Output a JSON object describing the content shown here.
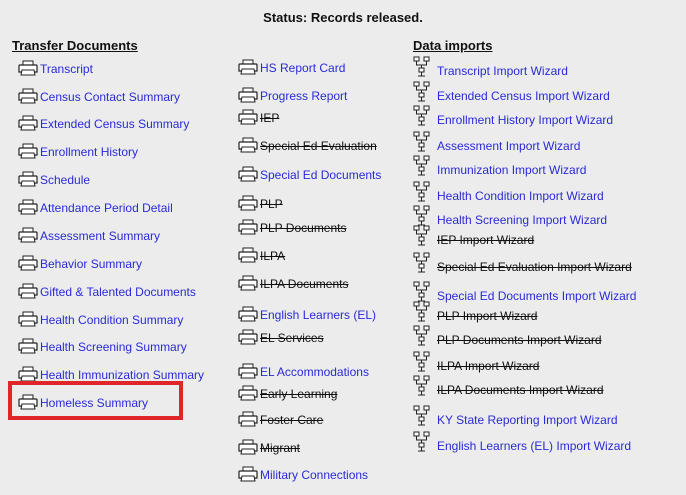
{
  "status": "Status: Records released.",
  "columns": {
    "transfer": {
      "header": "Transfer Documents",
      "items": [
        {
          "label": "Transcript",
          "struck": false
        },
        {
          "label": "Census Contact Summary",
          "struck": false
        },
        {
          "label": "Extended Census Summary",
          "struck": false
        },
        {
          "label": "Enrollment History",
          "struck": false
        },
        {
          "label": "Schedule",
          "struck": false
        },
        {
          "label": "Attendance Period Detail",
          "struck": false
        },
        {
          "label": "Assessment Summary",
          "struck": false
        },
        {
          "label": "Behavior Summary",
          "struck": false
        },
        {
          "label": "Gifted & Talented Documents",
          "struck": false
        },
        {
          "label": "Health Condition Summary",
          "struck": false
        },
        {
          "label": "Health Screening Summary",
          "struck": false
        },
        {
          "label": "Health Immunization Summary",
          "struck": false
        },
        {
          "label": "Homeless Summary",
          "struck": false
        }
      ]
    },
    "middle": {
      "items": [
        {
          "label": "HS Report Card",
          "struck": false
        },
        {
          "label": "Progress Report",
          "struck": false
        },
        {
          "label": "IEP",
          "struck": true
        },
        {
          "label": "Special Ed Evaluation",
          "struck": true
        },
        {
          "label": "Special Ed Documents",
          "struck": false
        },
        {
          "label": "PLP",
          "struck": true
        },
        {
          "label": "PLP Documents",
          "struck": true
        },
        {
          "label": "ILPA",
          "struck": true
        },
        {
          "label": "ILPA Documents",
          "struck": true
        },
        {
          "label": "English Learners (EL)",
          "struck": false
        },
        {
          "label": "EL Services",
          "struck": true
        },
        {
          "label": "EL Accommodations",
          "struck": false
        },
        {
          "label": "Early Learning",
          "struck": true
        },
        {
          "label": "Foster Care",
          "struck": true
        },
        {
          "label": "Migrant",
          "struck": true
        },
        {
          "label": "Military Connections",
          "struck": false
        }
      ]
    },
    "imports": {
      "header": "Data imports",
      "items": [
        {
          "label": "Transcript Import Wizard",
          "struck": false
        },
        {
          "label": "Extended Census Import Wizard",
          "struck": false
        },
        {
          "label": "Enrollment History Import Wizard",
          "struck": false
        },
        {
          "label": "Assessment Import Wizard",
          "struck": false
        },
        {
          "label": "Immunization Import Wizard",
          "struck": false
        },
        {
          "label": "Health Condition Import Wizard",
          "struck": false
        },
        {
          "label": "Health Screening Import Wizard",
          "struck": false
        },
        {
          "label": "IEP Import Wizard",
          "struck": true
        },
        {
          "label": "Special Ed Evaluation Import Wizard",
          "struck": true
        },
        {
          "label": "Special Ed Documents Import Wizard",
          "struck": false
        },
        {
          "label": "PLP Import Wizard",
          "struck": true
        },
        {
          "label": "PLP Documents Import Wizard",
          "struck": true
        },
        {
          "label": "ILPA Import Wizard",
          "struck": true
        },
        {
          "label": "ILPA Documents Import Wizard",
          "struck": true
        },
        {
          "label": "KY State Reporting Import Wizard",
          "struck": false
        },
        {
          "label": "English Learners (EL) Import Wizard",
          "struck": false
        }
      ]
    }
  },
  "highlight": {
    "item": "Homeless Summary",
    "color": "#e1262b"
  },
  "colors": {
    "link": "#2a2ad8",
    "struck": "#111111",
    "background": "#ececec"
  },
  "icons": {
    "document": "printer-icon",
    "import": "import-wizard-icon"
  }
}
